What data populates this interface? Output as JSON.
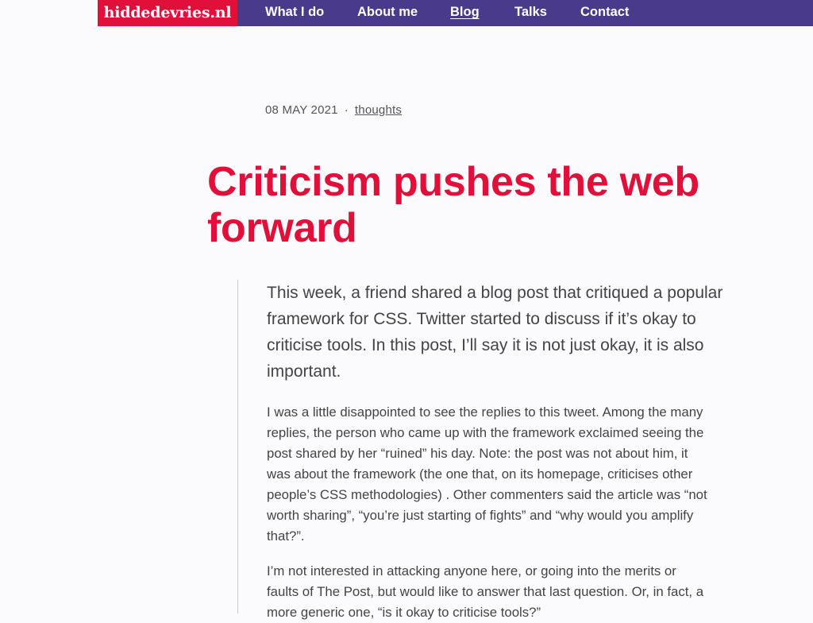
{
  "site": {
    "logo": "hiddedevries.nl"
  },
  "nav": {
    "items": [
      {
        "label": "What I do"
      },
      {
        "label": "About me"
      },
      {
        "label": "Blog",
        "active": true
      },
      {
        "label": "Talks"
      },
      {
        "label": "Contact"
      }
    ]
  },
  "article": {
    "date": "08 MAY 2021",
    "separator": "·",
    "category": "thoughts",
    "title": "Criticism pushes the web forward",
    "intro": "This week, a friend shared a blog post that critiqued a popular framework for CSS. Twitter started to discuss if it’s okay to criticise tools. In this post, I’ll say it is not just okay, it is also important.",
    "paragraphs": [
      "I was a little disappointed to see the replies to this tweet. Among the many replies, the person who came up with the framework exclaimed seeing the post shared by her “ruined” his day. Note: the post was not about him, it was about the framework (the one that, on its homepage, criticises other people’s CSS methodologies) . Other commenters said the article was “not worth sharing”, “you’re just starting of fights” and “why would you amplify that?”.",
      "I’m not interested in attacking anyone here, or going into the merits or faults of The Post, but would like to answer that last question. Or, in fact, a more generic one, “is it okay to criticise tools?”"
    ]
  },
  "colors": {
    "brand_red": "#e0103b",
    "nav_purple": "#4a3a8c",
    "background": "#fbfafc",
    "body_text": "#444444"
  }
}
